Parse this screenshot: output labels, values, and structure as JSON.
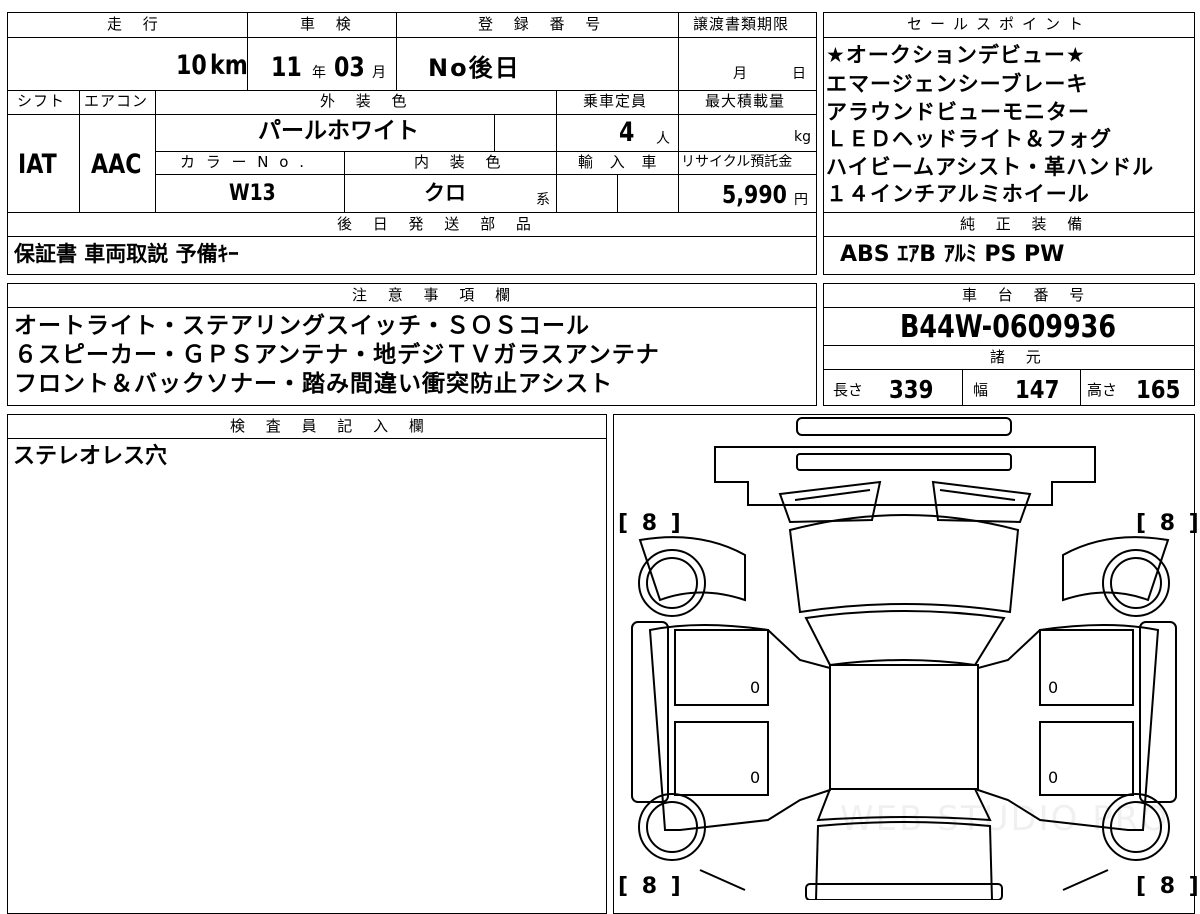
{
  "top_summary": {
    "mileage_label": "走 行",
    "mileage_value": "10",
    "mileage_unit": "km",
    "inspection_label": "車 検",
    "inspection_year": "11",
    "inspection_year_unit": "年",
    "inspection_month": "03",
    "inspection_month_unit": "月",
    "registration_label": "登 録 番 号",
    "registration_value": "No後日",
    "transfer_label": "譲渡書類期限",
    "transfer_month_unit": "月",
    "transfer_day_unit": "日",
    "shift_label": "シフト",
    "shift_value": "IAT",
    "ac_label": "エアコン",
    "ac_value": "AAC",
    "exterior_color_label": "外 装 色",
    "exterior_color_value": "パールホワイト",
    "capacity_label": "乗車定員",
    "capacity_value": "4",
    "capacity_unit": "人",
    "max_load_label": "最大積載量",
    "max_load_unit": "kg",
    "color_no_label": "カ ラ ー N o .",
    "color_no_value": "W13",
    "interior_label": "内 装 色",
    "interior_value": "クロ",
    "interior_suffix": "系",
    "import_label": "輸 入 車",
    "recycle_label": "リサイクル預託金",
    "recycle_value": "5,990",
    "recycle_unit": "円"
  },
  "later_parts": {
    "header": "後 日 発 送 部 品",
    "items": "保証書 車両取説 予備ｷｰ"
  },
  "sales_points": {
    "header": "セールスポイント",
    "lines": [
      "★オークションデビュー★",
      "エマージェンシーブレーキ",
      "アラウンドビューモニター",
      "ＬＥＤヘッドライト＆フォグ",
      "ハイビームアシスト・革ハンドル",
      "１４インチアルミホイール"
    ]
  },
  "standard_equipment": {
    "header": "純 正 装 備",
    "items": "ABS ｴｱB ｱﾙﾐ PS PW"
  },
  "notes": {
    "header": "注 意 事 項 欄",
    "lines": [
      "オートライト・ステアリングスイッチ・ＳＯＳコール",
      "６スピーカー・ＧＰＳアンテナ・地デジＴＶガラスアンテナ",
      "フロント＆バックソナー・踏み間違い衝突防止アシスト"
    ]
  },
  "chassis": {
    "header": "車 台 番 号",
    "value": "B44W-0609936"
  },
  "specs": {
    "header": "諸 元",
    "length_label": "長さ",
    "length_value": "339",
    "width_label": "幅",
    "width_value": "147",
    "height_label": "高さ",
    "height_value": "165"
  },
  "inspector": {
    "header": "検 査 員 記 入 欄",
    "comment": "ステレオレス穴"
  },
  "diagram": {
    "tire_front_left": "[ 8 ]",
    "tire_front_right": "[ 8 ]",
    "tire_rear_left": "[ 8 ]",
    "tire_rear_right": "[ 8 ]",
    "panel_values": [
      "0",
      "0",
      "0",
      "0"
    ],
    "watermark": "WEB STUDIO PRO"
  }
}
